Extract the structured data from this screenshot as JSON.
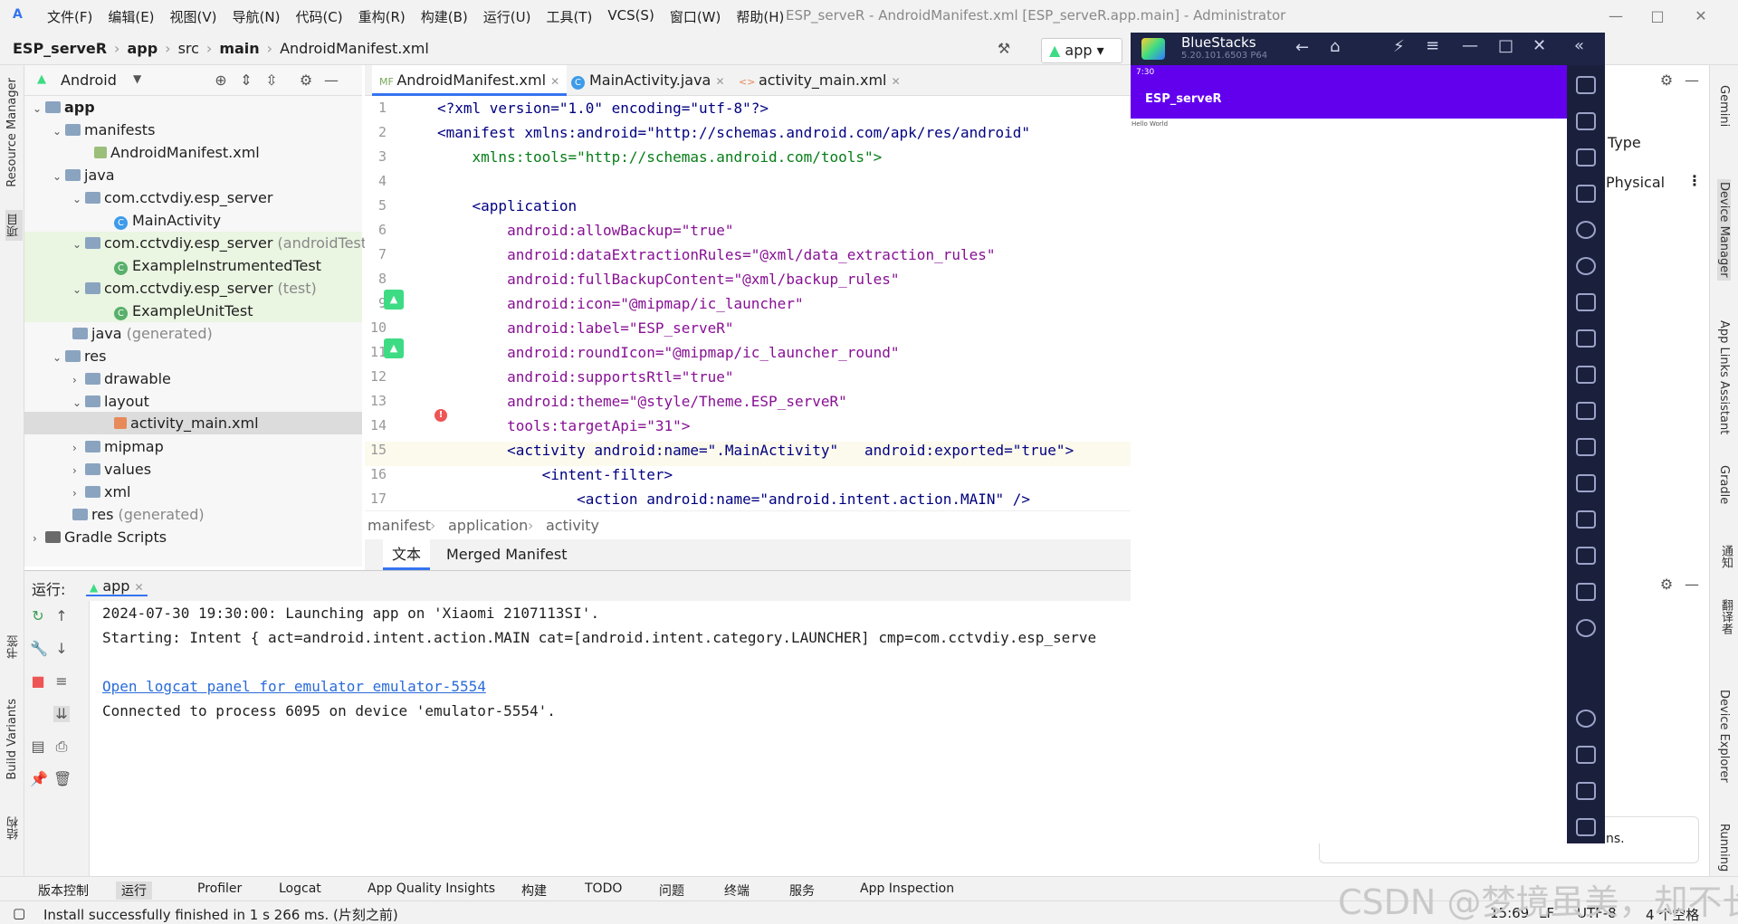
{
  "titlebar": {
    "menu": [
      "文件(F)",
      "编辑(E)",
      "视图(V)",
      "导航(N)",
      "代码(C)",
      "重构(R)",
      "构建(B)",
      "运行(U)",
      "工具(T)",
      "VCS(S)",
      "窗口(W)",
      "帮助(H)"
    ],
    "window_title": "ESP_serveR - AndroidManifest.xml [ESP_serveR.app.main] - Administrator"
  },
  "breadcrumb": {
    "project": "ESP_serveR",
    "module": "app",
    "src": "src",
    "main": "main",
    "file": "AndroidManifest.xml"
  },
  "run_config": {
    "label": "app"
  },
  "left_strip": {
    "resource_manager": "Resource Manager",
    "project": "项目",
    "bookmarks": "书签",
    "build_variants": "Build Variants",
    "structure": "结构"
  },
  "project_panel": {
    "view": "Android",
    "tree": [
      {
        "label": "app",
        "bold": true
      },
      {
        "label": "manifests"
      },
      {
        "label": "AndroidManifest.xml"
      },
      {
        "label": "java"
      },
      {
        "label": "com.cctvdiy.esp_server"
      },
      {
        "label": "MainActivity"
      },
      {
        "label": "com.cctvdiy.esp_server",
        "suffix": "(androidTest)"
      },
      {
        "label": "ExampleInstrumentedTest"
      },
      {
        "label": "com.cctvdiy.esp_server",
        "suffix": "(test)"
      },
      {
        "label": "ExampleUnitTest"
      },
      {
        "label": "java",
        "suffix": "(generated)"
      },
      {
        "label": "res"
      },
      {
        "label": "drawable"
      },
      {
        "label": "layout"
      },
      {
        "label": "activity_main.xml"
      },
      {
        "label": "mipmap"
      },
      {
        "label": "values"
      },
      {
        "label": "xml"
      },
      {
        "label": "res",
        "suffix": "(generated)"
      },
      {
        "label": "Gradle Scripts"
      }
    ]
  },
  "editor": {
    "tabs": [
      "AndroidManifest.xml",
      "MainActivity.java",
      "activity_main.xml"
    ],
    "line_numbers": [
      "1",
      "2",
      "3",
      "4",
      "5",
      "6",
      "7",
      "8",
      "9",
      "10",
      "11",
      "12",
      "13",
      "14",
      "15",
      "16",
      "17"
    ],
    "lines": [
      "<?xml version=\"1.0\" encoding=\"utf-8\"?>",
      "<manifest xmlns:android=\"http://schemas.android.com/apk/res/android\"",
      "    xmlns:tools=\"http://schemas.android.com/tools\">",
      "",
      "    <application",
      "        android:allowBackup=\"true\"",
      "        android:dataExtractionRules=\"@xml/data_extraction_rules\"",
      "        android:fullBackupContent=\"@xml/backup_rules\"",
      "        android:icon=\"@mipmap/ic_launcher\"",
      "        android:label=\"ESP_serveR\"",
      "        android:roundIcon=\"@mipmap/ic_launcher_round\"",
      "        android:supportsRtl=\"true\"",
      "        android:theme=\"@style/Theme.ESP_serveR\"",
      "        tools:targetApi=\"31\">",
      "        <activity android:name=\".MainActivity\"   android:exported=\"true\">",
      "            <intent-filter>",
      "                <action android:name=\"android.intent.action.MAIN\" />"
    ],
    "breadcrumb": [
      "manifest",
      "application",
      "activity"
    ],
    "bottom_tabs": [
      "文本",
      "Merged Manifest"
    ]
  },
  "run_panel": {
    "label": "运行:",
    "tab": "app",
    "console": [
      "2024-07-30 19:30:00: Launching app on 'Xiaomi 2107113SI'.",
      "Starting: Intent { act=android.intent.action.MAIN cat=[android.intent.category.LAUNCHER] cmp=com.cctvdiy.esp_serve",
      "",
      "Open logcat panel for emulator emulator-5554",
      "Connected to process 6095 on device 'emulator-5554'."
    ]
  },
  "bluestacks": {
    "title": "BlueStacks",
    "version": "5.20.101.6503  P64",
    "status_time": "7:30",
    "app_title": "ESP_serveR",
    "hello": "Hello World"
  },
  "device_manager": {
    "type_label": "Type",
    "physical_label": "Physical",
    "ghost_text": "ns."
  },
  "right_strip": {
    "gemini": "Gemini",
    "device_manager": "Device Manager",
    "app_links": "App Links Assistant",
    "gradle": "Gradle",
    "notifications": "通知",
    "assistant": "翻译者",
    "device_explorer": "Device Explorer",
    "running_devices": "Running D"
  },
  "bottom_toolbar": [
    "版本控制",
    "运行",
    "Profiler",
    "Logcat",
    "App Quality Insights",
    "构建",
    "TODO",
    "问题",
    "终端",
    "服务",
    "App Inspection"
  ],
  "status": {
    "message": "Install successfully finished in 1 s 266 ms. (片刻之前)",
    "position": "15:69",
    "line_sep": "LF",
    "encoding": "UTF-8",
    "indent": "4 个空格"
  },
  "watermark": "CSDN @梦境虽美，却不长"
}
